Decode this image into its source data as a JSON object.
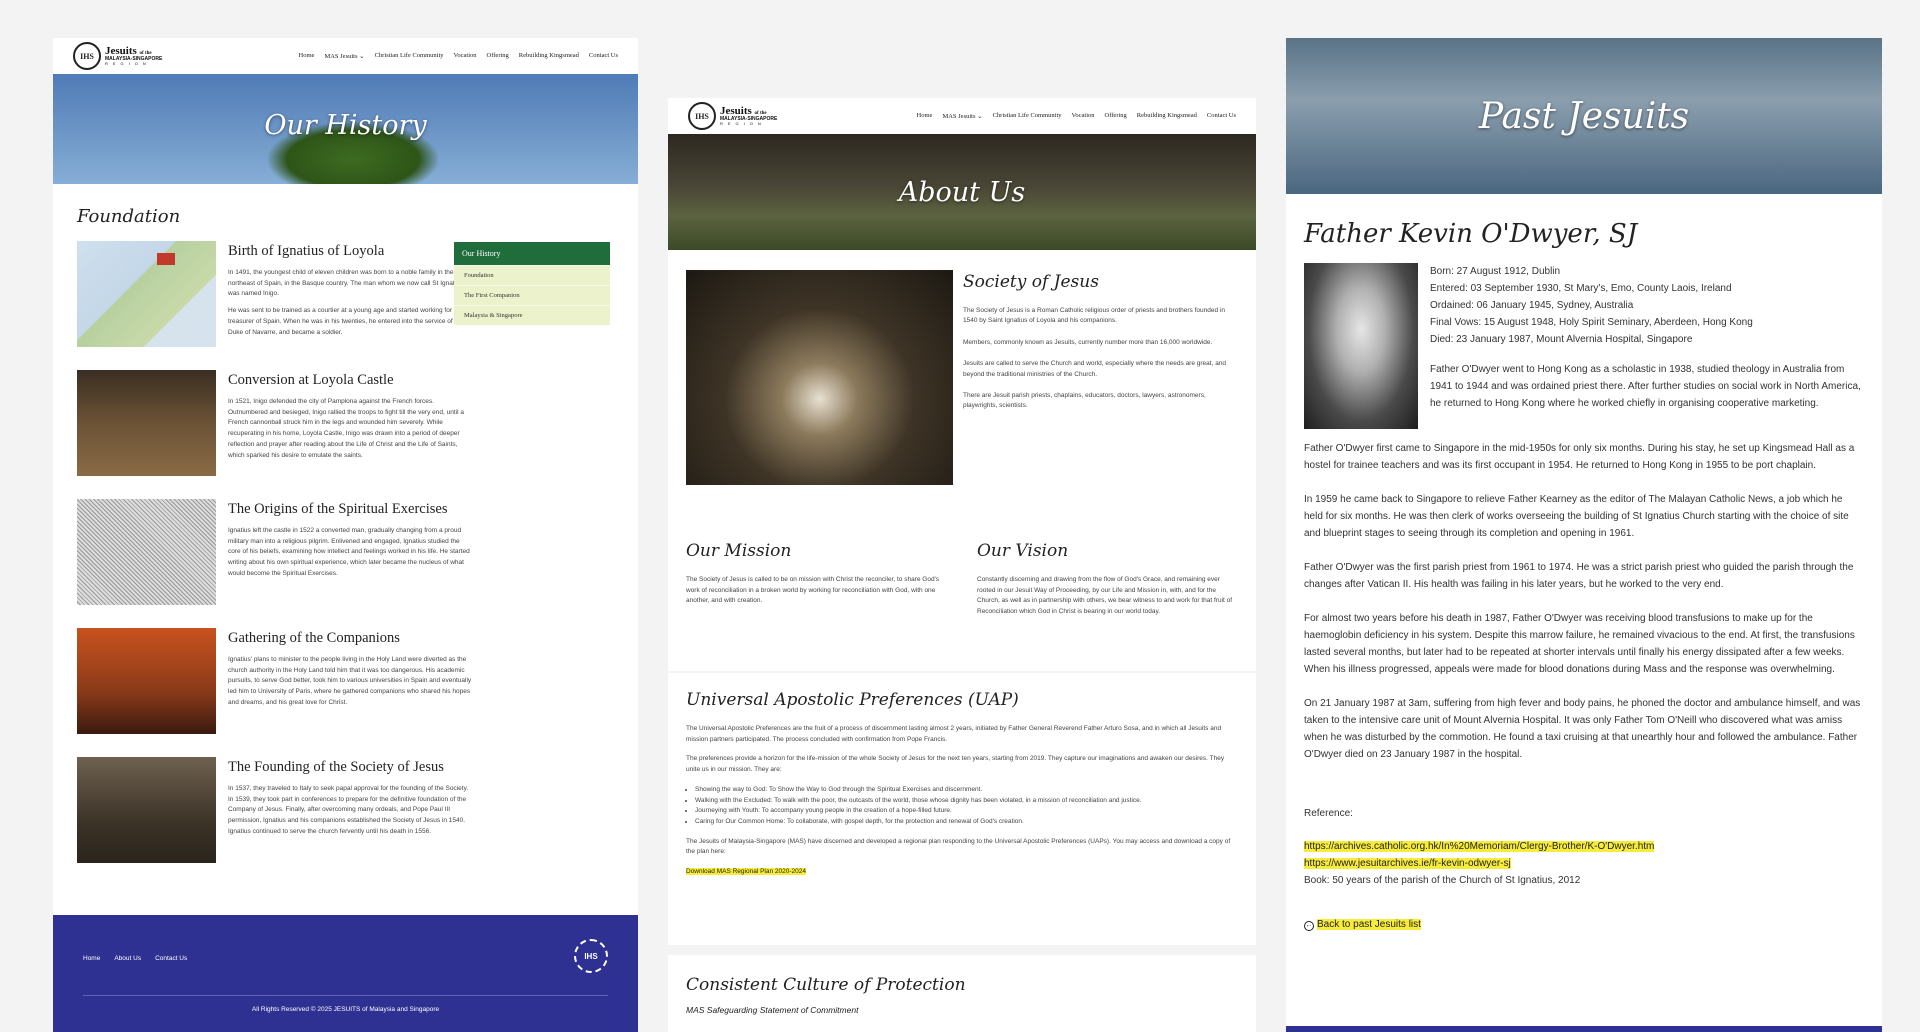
{
  "brand": {
    "name": "Jesuits",
    "name_small": "of the",
    "sub": "MALAYSIA-SINGAPORE",
    "region": "REGION",
    "seal": "IHS"
  },
  "nav": [
    "Home",
    "MAS Jesuits ⌄",
    "Christian Life Community",
    "Vocation",
    "Offering",
    "Rebuilding Kingsmead",
    "Contact Us"
  ],
  "history": {
    "hero_title": "Our History",
    "section_title": "Foundation",
    "entries": [
      {
        "title": "Birth of Ignatius of Loyola",
        "p1": "In 1491, the youngest child of eleven children was born to a noble family in the northeast of Spain, in the Basque country. The man whom we now call St Ignatius, was named Inigo.",
        "p2": "He was sent to be trained as a courtier at a young age and started working for the treasurer of Spain. When he was in his twenties, he entered into the service of the Duke of Navarre, and became a soldier."
      },
      {
        "title": "Conversion at Loyola Castle",
        "p1": "In 1521, Inigo defended the city of Pamplona against the French forces. Outnumbered and besieged, Inigo rallied the troops to fight till the very end, until a French cannonball struck him in the legs and wounded him severely. While recuperating in his home, Loyola Castle, Inigo was drawn into a period of deeper reflection and prayer after reading about the Life of Christ and the Life of Saints, which sparked his desire to emulate the saints.",
        "p2": ""
      },
      {
        "title": "The Origins of the Spiritual Exercises",
        "p1": "Ignatius left the castle in 1522 a converted man, gradually changing from a proud military man into a religious pilgrim. Enlivened and engaged, Ignatius studied the core of his beliefs, examining how intellect and feelings worked in his life. He started writing about his own spiritual experience, which later became the nucleus of what would become the Spiritual Exercises.",
        "p2": ""
      },
      {
        "title": "Gathering of the Companions",
        "p1": "Ignatius' plans to minister to the people living in the Holy Land were diverted as the church authority in the Holy Land told him that it was too dangerous. His academic pursuits, to serve God better, took him to various universities in Spain and eventually led him to University of Paris, where he gathered companions who shared his hopes and dreams, and his great love for Christ.",
        "p2": ""
      },
      {
        "title": "The Founding of the Society of Jesus",
        "p1": "In 1537, they traveled to Italy to seek papal approval for the founding of the Society. In 1539, they took part in conferences to prepare for the definitive foundation of the Company of Jesus. Finally, after overcoming many ordeals, and Pope Paul III permission, Ignatius and his companions established the Society of Jesus in 1540. Ignatius continued to serve the church fervently until his death in 1556.",
        "p2": ""
      }
    ],
    "sidebar": {
      "header": "Our History",
      "items": [
        "Foundation",
        "The First Companion",
        "Malaysia & Singapore"
      ]
    },
    "footer": {
      "links": [
        "Home",
        "About Us",
        "Contact Us"
      ],
      "copyright": "All Rights Reserved © 2025 JESUITS of Malaysia and Singapore"
    }
  },
  "about": {
    "hero_title": "About Us",
    "society": {
      "title": "Society of Jesus",
      "paras": [
        "The Society of Jesus is a Roman Catholic religious order of priests and brothers founded in 1540 by Saint Ignatius of Loyola and his companions.",
        "Members, commonly known as Jesuits, currently number more than 16,000 worldwide.",
        "Jesuits are called to serve the Church and world, especially where the needs are great, and beyond the traditional ministries of the Church.",
        "There are Jesuit parish priests, chaplains, educators, doctors, lawyers, astronomers, playwrights, scientists."
      ]
    },
    "mission": {
      "title": "Our Mission",
      "text": "The Society of Jesus is called to be on mission with Christ the reconciler, to share God's work of reconciliation in a broken world by working for reconciliation with God, with one another, and with creation."
    },
    "vision": {
      "title": "Our Vision",
      "text": "Constantly discerning and drawing from the flow of God's Grace, and remaining ever rooted in our Jesuit Way of Proceeding, by our Life and Mission in, with, and for the Church, as well as in partnership with others, we bear witness to and work for that fruit of Reconciliation which God in Christ is bearing in our world today."
    },
    "uap": {
      "title": "Universal Apostolic Preferences (UAP)",
      "p1": "The Universal Apostolic Preferences are the fruit of a process of discernment lasting almost 2 years, initiated by Father General Reverend Father Arturo Sosa, and in which all Jesuits and mission partners participated. The process concluded with confirmation from Pope Francis.",
      "p2": "The preferences provide a horizon for the life-mission of the whole Society of Jesus for the next ten years, starting from 2019. They capture our imaginations and awaken our desires. They unite us in our mission. They are:",
      "bullets": [
        "Showing the way to God: To Show the Way to God through the Spiritual Exercises and discernment.",
        "Walking with the Excluded: To walk with the poor, the outcasts of the world, those whose dignity has been violated, in a mission of reconciliation and justice.",
        "Journeying with Youth: To accompany young people in the creation of a hope-filled future.",
        "Caring for Our Common Home: To collaborate, with gospel depth, for the protection and renewal of God's creation."
      ],
      "p3": "The Jesuits of Malaysia-Singapore (MAS) have discerned and developed a regional plan responding to the Universal Apostolic Preferences (UAPs). You may access and download a copy of the plan here:",
      "download": "Download MAS Regional Plan 2020-2024"
    },
    "ccp": {
      "title": "Consistent Culture of Protection",
      "subtitle": "MAS Safeguarding Statement of Commitment"
    }
  },
  "past": {
    "hero_title": "Past Jesuits",
    "name": "Father Kevin O'Dwyer, SJ",
    "facts": [
      "Born: 27 August 1912, Dublin",
      "Entered: 03 September 1930, St Mary's, Emo, County Laois, Ireland",
      "Ordained: 06 January 1945, Sydney, Australia",
      "Final Vows: 15 August 1948, Holy Spirit Seminary, Aberdeen, Hong Kong",
      "Died: 23 January 1987, Mount Alvernia Hospital, Singapore"
    ],
    "intro": "Father O'Dwyer went to Hong Kong as a scholastic in 1938, studied theology in Australia from 1941 to 1944 and was ordained priest there. After further studies on social work in North America, he returned to Hong Kong where he worked chiefly in organising cooperative marketing.",
    "paras": [
      "Father O'Dwyer first came to Singapore in the mid-1950s for only six months. During his stay, he set up Kingsmead Hall as a hostel for trainee teachers and was its first occupant in 1954. He returned to Hong Kong in 1955 to be port chaplain.",
      "In 1959 he came back to Singapore to relieve Father Kearney as the editor of The Malayan Catholic News, a job which he held for six months. He was then clerk of works overseeing the building of St Ignatius Church starting with the choice of site and blueprint stages to seeing through its completion and opening in 1961.",
      "Father O'Dwyer was the first parish priest from 1961 to 1974. He was a strict parish priest who guided the parish through the changes after Vatican II. His health was failing in his later years, but he worked to the very end.",
      "For almost two years before his death in 1987, Father O'Dwyer was receiving blood transfusions to make up for the haemoglobin deficiency in his system. Despite this marrow failure, he remained vivacious to the end. At first, the transfusions lasted several months, but later had to be repeated at shorter intervals until finally his energy dissipated after a few weeks. When his illness progressed, appeals were made for blood donations during Mass and the response was overwhelming.",
      "On 21 January 1987 at 3am, suffering from high fever and body pains, he phoned the doctor and ambulance himself, and was taken to the intensive care unit of Mount Alvernia Hospital. It was only Father Tom O'Neill who discovered what was amiss when he was disturbed by the commotion. He found a taxi cruising at that unearthly hour and followed the ambulance. Father O'Dwyer died on 23 January 1987 in the hospital."
    ],
    "reference_label": "Reference:",
    "links": [
      "https://archives.catholic.org.hk/In%20Memoriam/Clergy-Brother/K-O'Dwyer.htm",
      "https://www.jesuitarchives.ie/fr-kevin-odwyer-sj"
    ],
    "book": "Book: 50 years of the parish of the Church of St Ignatius, 2012",
    "back": "Back to past Jesuits list"
  },
  "colors": {
    "footer_blue": "#2e3192",
    "sidebar_green": "#1f6d3a",
    "sidebar_item_bg": "#ecf2cb",
    "highlight_yellow": "#f7ec3a"
  }
}
